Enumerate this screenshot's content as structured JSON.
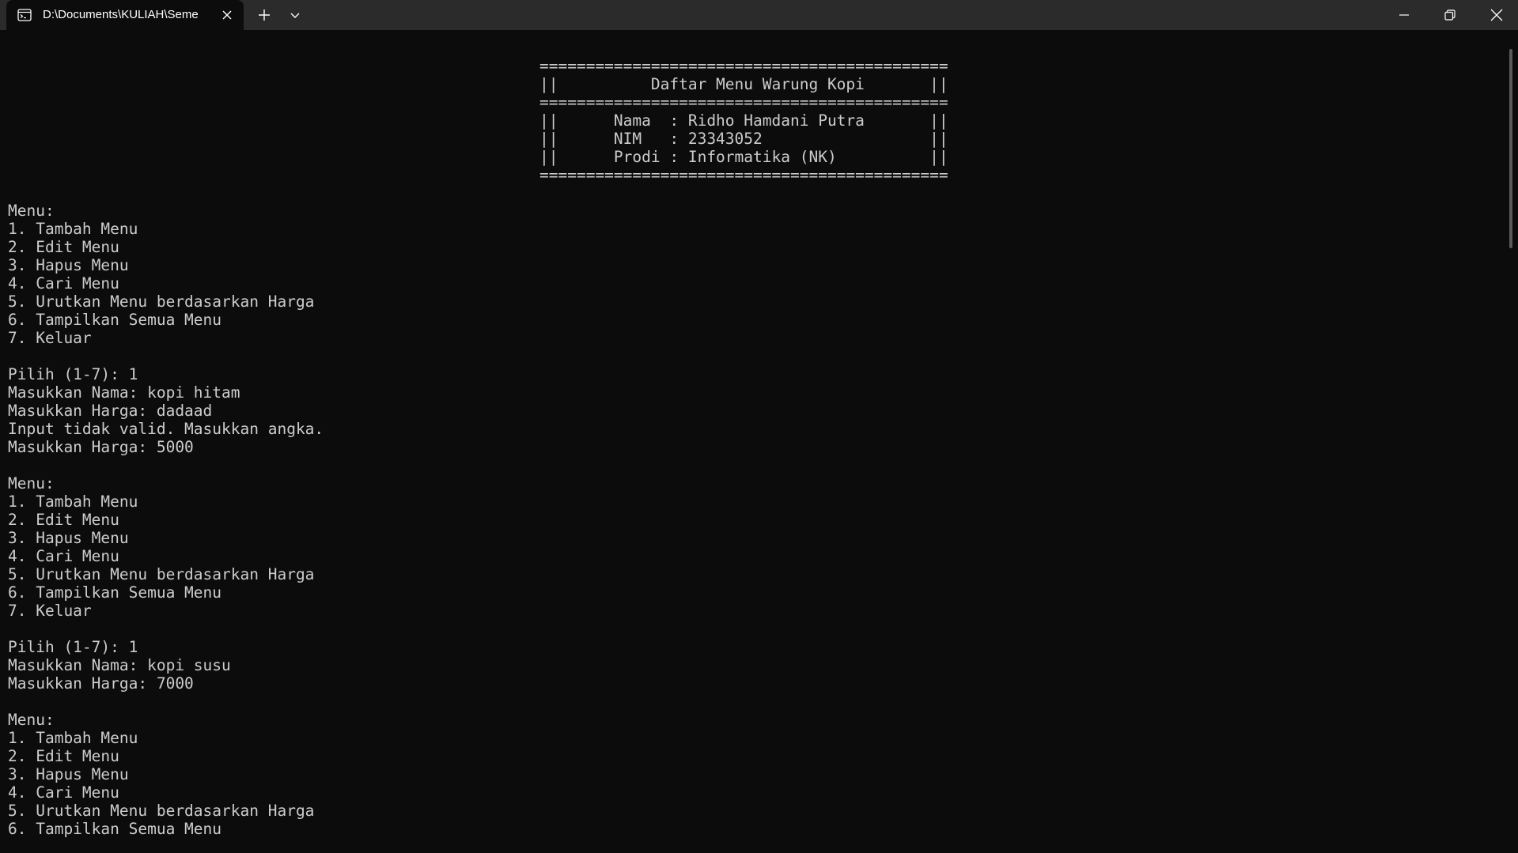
{
  "window": {
    "tab_title": "D:\\Documents\\KULIAH\\Seme",
    "icons": {
      "tab": "terminal-icon",
      "close_tab": "close-icon",
      "new_tab": "plus-icon",
      "dropdown": "chevron-down-icon",
      "minimize": "minimize-icon",
      "maximize": "restore-icon",
      "close": "close-icon"
    }
  },
  "banner": {
    "line1": "============================================",
    "line2": "||          Daftar Menu Warung Kopi       ||",
    "line3": "============================================",
    "line4": "||      Nama  : Ridho Hamdani Putra       ||",
    "line5": "||      NIM   : 23343052                  ||",
    "line6": "||      Prodi : Informatika (NK)          ||",
    "line7": "============================================"
  },
  "output_lines": [
    "Menu:",
    "1. Tambah Menu",
    "2. Edit Menu",
    "3. Hapus Menu",
    "4. Cari Menu",
    "5. Urutkan Menu berdasarkan Harga",
    "6. Tampilkan Semua Menu",
    "7. Keluar",
    "",
    "Pilih (1-7): 1",
    "Masukkan Nama: kopi hitam",
    "Masukkan Harga: dadaad",
    "Input tidak valid. Masukkan angka.",
    "Masukkan Harga: 5000",
    "",
    "Menu:",
    "1. Tambah Menu",
    "2. Edit Menu",
    "3. Hapus Menu",
    "4. Cari Menu",
    "5. Urutkan Menu berdasarkan Harga",
    "6. Tampilkan Semua Menu",
    "7. Keluar",
    "",
    "Pilih (1-7): 1",
    "Masukkan Nama: kopi susu",
    "Masukkan Harga: 7000",
    "",
    "Menu:",
    "1. Tambah Menu",
    "2. Edit Menu",
    "3. Hapus Menu",
    "4. Cari Menu",
    "5. Urutkan Menu berdasarkan Harga",
    "6. Tampilkan Semua Menu"
  ]
}
